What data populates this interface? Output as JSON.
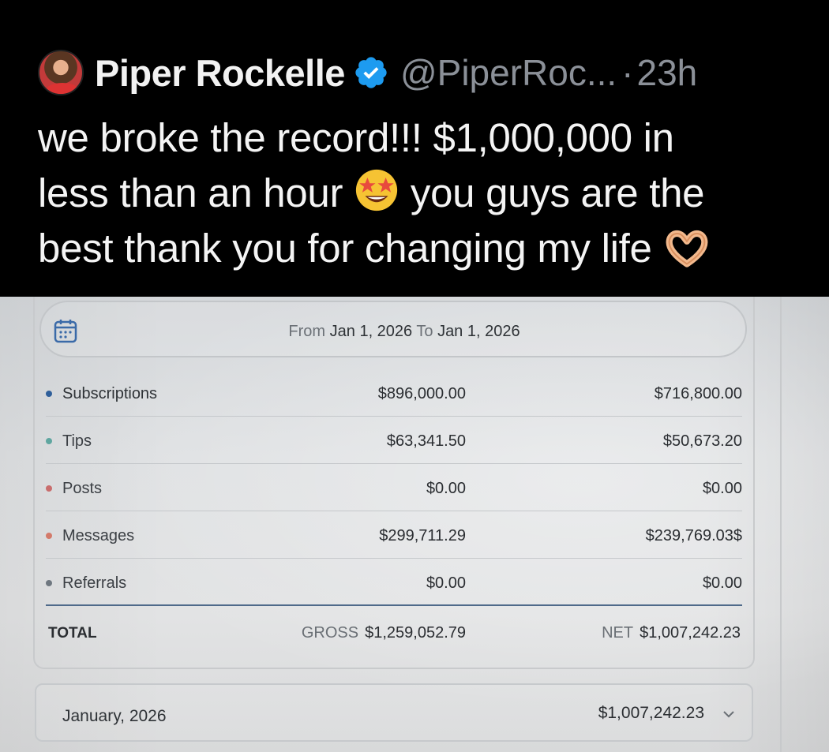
{
  "tweet": {
    "author_name": "Piper Rockelle",
    "handle": "@PiperRoc...",
    "separator": "·",
    "time": "23h",
    "verified": true,
    "text_lines": [
      "we broke the record!!! $1,000,000 in",
      "less than an hour",
      "you guys are the",
      "best thank you for changing my life"
    ],
    "emoji_1": "star-struck-emoji",
    "emoji_2": "heart-hands-emoji"
  },
  "statement": {
    "date_range": {
      "from_label": "From",
      "from_date": "Jan 1, 2026",
      "to_label": "To",
      "to_date": "Jan 1, 2026"
    },
    "rows": [
      {
        "label": "Subscriptions",
        "gross": "$896,000.00",
        "net": "$716,800.00",
        "bullet_color": "#2f5f9a"
      },
      {
        "label": "Tips",
        "gross": "$63,341.50",
        "net": "$50,673.20",
        "bullet_color": "#5fa6a0"
      },
      {
        "label": "Posts",
        "gross": "$0.00",
        "net": "$0.00",
        "bullet_color": "#c96d6d"
      },
      {
        "label": "Messages",
        "gross": "$299,711.29",
        "net": "$239,769.03$",
        "bullet_color": "#d37a6a"
      },
      {
        "label": "Referrals",
        "gross": "$0.00",
        "net": "$0.00",
        "bullet_color": "#6f7780"
      }
    ],
    "total": {
      "label": "TOTAL",
      "gross_tag": "GROSS",
      "gross": "$1,259,052.79",
      "net_tag": "NET",
      "net": "$1,007,242.23"
    },
    "month": {
      "label": "January, 2026",
      "amount": "$1,007,242.23"
    }
  },
  "colors": {
    "verified_blue": "#1d9bf0",
    "calendar_blue": "#3a6aa8",
    "divider_accent": "#4f6a8a"
  }
}
